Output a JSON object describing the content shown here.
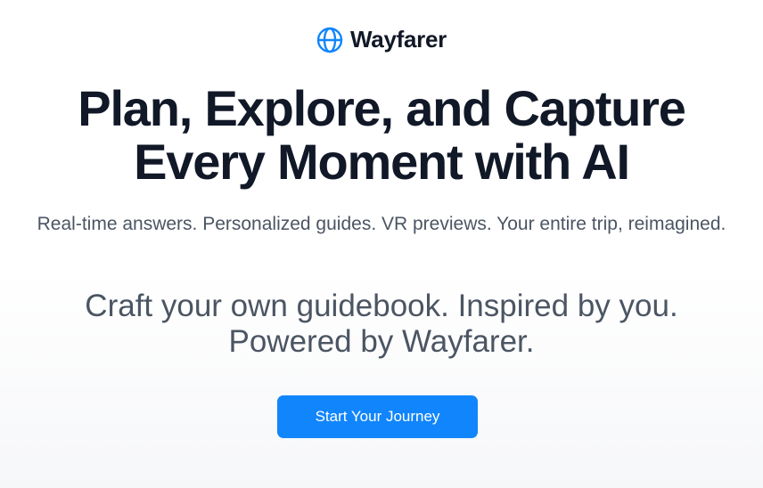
{
  "brand": {
    "name": "Wayfarer",
    "icon": "globe-icon",
    "icon_color": "#1185fb"
  },
  "hero": {
    "headline_line1": "Plan, Explore, and Capture",
    "headline_line2": "Every Moment with AI",
    "subheadline": "Real-time answers. Personalized guides. VR previews. Your entire trip, reimagined.",
    "tagline_line1": "Craft your own guidebook. Inspired by you.",
    "tagline_line2": "Powered by Wayfarer."
  },
  "cta": {
    "label": "Start Your Journey",
    "color": "#1185fb"
  }
}
